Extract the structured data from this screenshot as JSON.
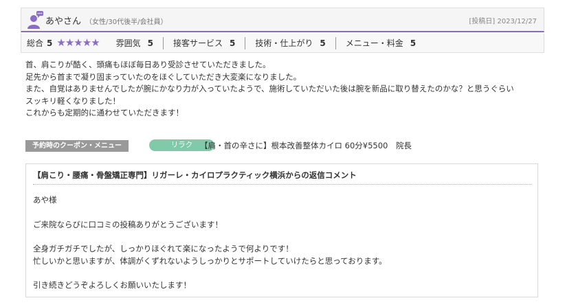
{
  "reviewer": {
    "name": "あやさん",
    "attributes": "（女性/30代後半/会社員）",
    "post_date": "[投稿日] 2023/12/27",
    "avatar_icon": "user-avatar-icon"
  },
  "ratings": {
    "overall_label": "総合",
    "overall_value": "5",
    "stars": 5,
    "star_color": "#8b6cc4",
    "items": [
      {
        "label": "雰囲気",
        "value": "5"
      },
      {
        "label": "接客サービス",
        "value": "5"
      },
      {
        "label": "技術・仕上がり",
        "value": "5"
      },
      {
        "label": "メニュー・料金",
        "value": "5"
      }
    ]
  },
  "review": {
    "lines": [
      "首、肩こりが酷く、頭痛もほぼ毎日あり受診させていただきました。",
      "足先から首まで凝り固まっていたのをほぐしていただき大変楽になりました。",
      "また、自覚はありませんでしたが腕にかなり力が入っていたようで、施術していただいた後は腕を新品に取り替えたのかな？と思うぐらい",
      "スッキリ軽くなりました！",
      "これからも定期的に通わせていただきます！"
    ]
  },
  "coupon": {
    "label": "予約時のクーポン・メニュー",
    "tag": "リラク",
    "menu": "【肩・首の辛さに】根本改善整体カイロ 60分¥5500　院長"
  },
  "reply": {
    "title": "【肩こり・腰痛・骨盤矯正専門】リガーレ・カイロプラクティック横浜からの返信コメント",
    "lines": [
      "あや様",
      "ご来院ならびに口コミの投稿ありがとうございます！",
      "全身ガチガチでしたが、しっかりほぐれて楽になったようで何よりです！",
      "忙しいかと思いますが、体調がくずれないようしっかりとサポートしていけたらと思っております。",
      "引き続きどうぞよろしくお願いいたします！"
    ]
  }
}
